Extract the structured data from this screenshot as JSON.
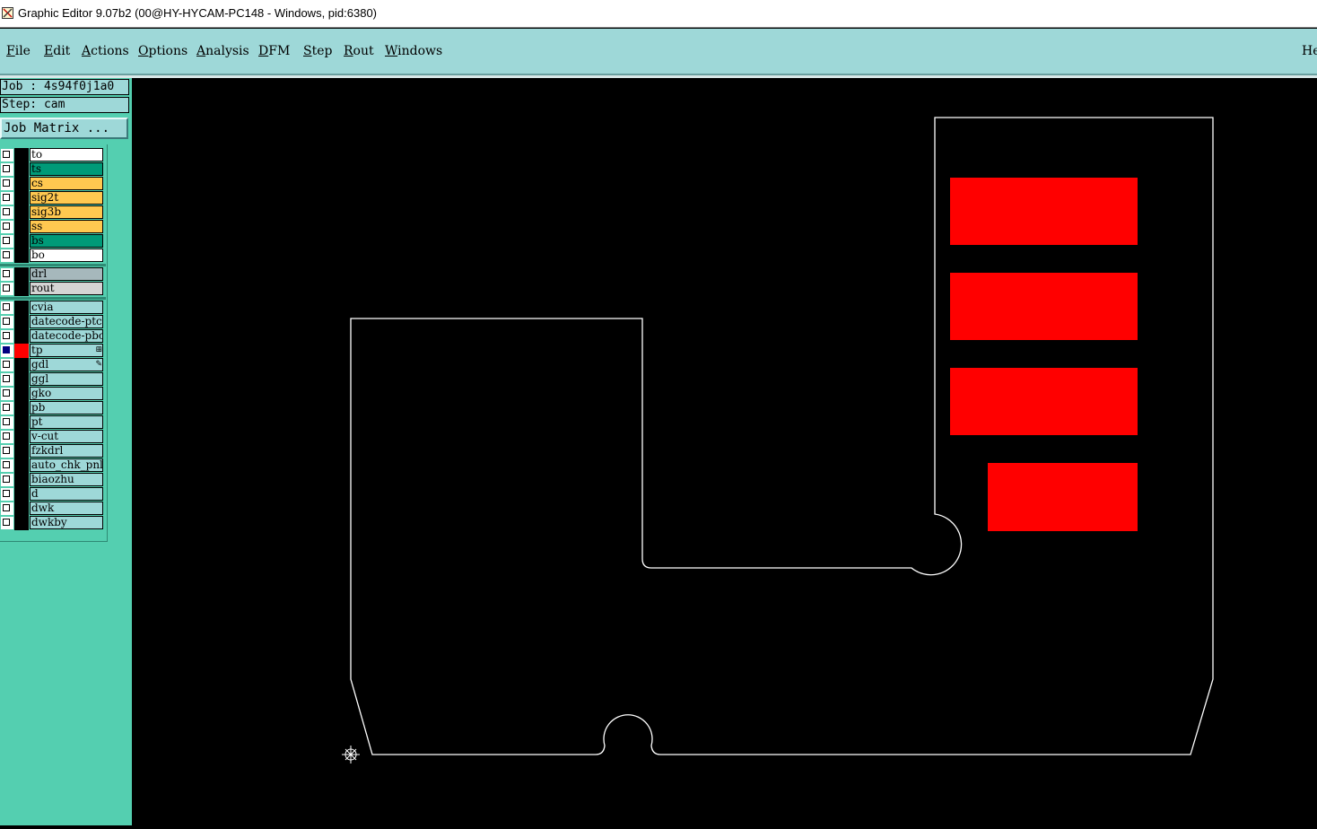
{
  "window": {
    "title": "Graphic Editor 9.07b2 (00@HY-HYCAM-PC148 - Windows, pid:6380)",
    "icon": "app-icon"
  },
  "menu": {
    "items": [
      {
        "label": "File",
        "mnemonic": "F",
        "rest": "ile"
      },
      {
        "label": "Edit",
        "mnemonic": "E",
        "rest": "dit"
      },
      {
        "label": "Actions",
        "mnemonic": "A",
        "rest": "ctions"
      },
      {
        "label": "Options",
        "mnemonic": "O",
        "rest": "ptions"
      },
      {
        "label": "Analysis",
        "mnemonic": "A",
        "rest": "nalysis"
      },
      {
        "label": "DFM",
        "mnemonic": "D",
        "rest": "FM"
      },
      {
        "label": "Step",
        "mnemonic": "S",
        "rest": "tep"
      },
      {
        "label": "Rout",
        "mnemonic": "R",
        "rest": "out"
      },
      {
        "label": "Windows",
        "mnemonic": "W",
        "rest": "indows"
      }
    ],
    "help": "He"
  },
  "panel": {
    "job": "Job : 4s94f0j1a0",
    "step": "Step: cam",
    "job_matrix_button": "Job Matrix ..."
  },
  "layers": {
    "board": [
      {
        "name": "to",
        "color": "#ffffff",
        "active": false
      },
      {
        "name": "ts",
        "color": "#009a78",
        "active": false
      },
      {
        "name": "cs",
        "color": "#ffc850",
        "active": false
      },
      {
        "name": "sig2t",
        "color": "#ffc850",
        "active": false
      },
      {
        "name": "sig3b",
        "color": "#ffc850",
        "active": false
      },
      {
        "name": "ss",
        "color": "#ffc850",
        "active": false
      },
      {
        "name": "bs",
        "color": "#009a78",
        "active": false
      },
      {
        "name": "bo",
        "color": "#ffffff",
        "active": false
      }
    ],
    "drill": [
      {
        "name": "drl",
        "color": "#a6b8bc",
        "active": false
      },
      {
        "name": "rout",
        "color": "#d4d4d4",
        "active": false
      }
    ],
    "misc": [
      {
        "name": "cvia",
        "color": "#9ed8d8",
        "active": false
      },
      {
        "name": "datecode-ptc",
        "color": "#9ed8d8",
        "active": false
      },
      {
        "name": "datecode-pbc",
        "color": "#9ed8d8",
        "active": false
      },
      {
        "name": "tp",
        "color": "#9ed8d8",
        "active": true,
        "mark": "⊞"
      },
      {
        "name": "gdl",
        "color": "#9ed8d8",
        "active": false,
        "mark": "✎"
      },
      {
        "name": "ggl",
        "color": "#9ed8d8",
        "active": false
      },
      {
        "name": "gko",
        "color": "#9ed8d8",
        "active": false
      },
      {
        "name": "pb",
        "color": "#9ed8d8",
        "active": false
      },
      {
        "name": "pt",
        "color": "#9ed8d8",
        "active": false
      },
      {
        "name": "v-cut",
        "color": "#9ed8d8",
        "active": false
      },
      {
        "name": "fzkdrl",
        "color": "#9ed8d8",
        "active": false
      },
      {
        "name": "auto_chk_pnl",
        "color": "#9ed8d8",
        "active": false
      },
      {
        "name": "biaozhu",
        "color": "#9ed8d8",
        "active": false
      },
      {
        "name": "d",
        "color": "#9ed8d8",
        "active": false
      },
      {
        "name": "dwk",
        "color": "#9ed8d8",
        "active": false
      },
      {
        "name": "dwkby",
        "color": "#9ed8d8",
        "active": false
      }
    ]
  },
  "canvas": {
    "background": "#000000",
    "outline_color": "#ffffff",
    "pad_color": "#ff0000",
    "pad_count": 4,
    "origin_marker": "origin-crosshair-icon"
  }
}
